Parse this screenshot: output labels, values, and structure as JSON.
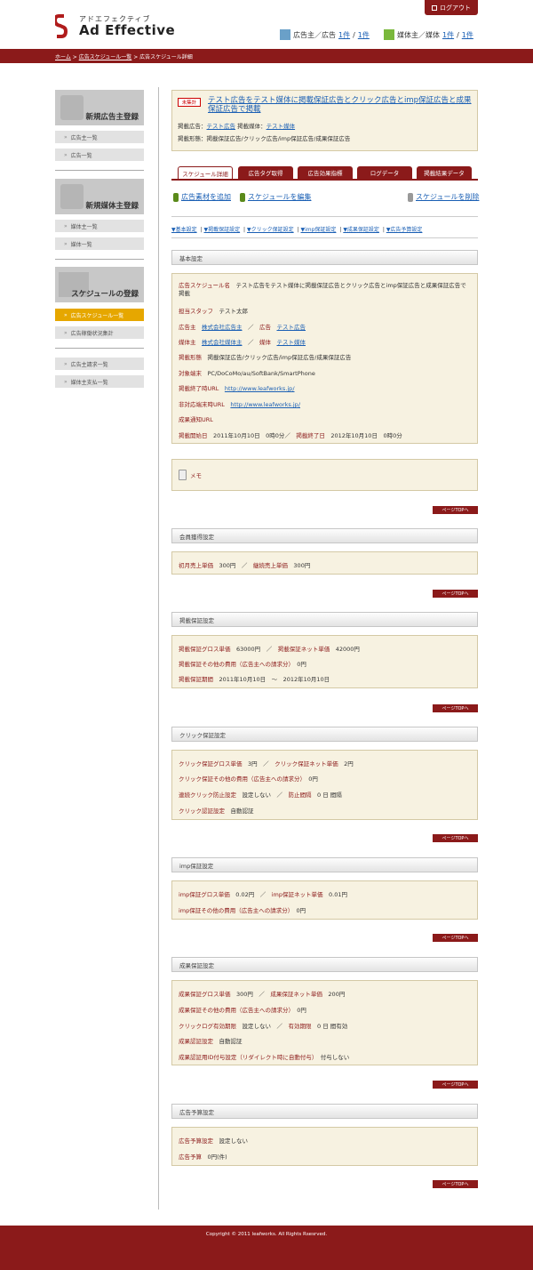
{
  "header": {
    "logout_label": "ログアウト",
    "logo_kana": "アドエフェクティブ",
    "logo_text": "Ad Effective",
    "advertiser_stat_label": "広告主／広告",
    "advertiser_count_a": "1件",
    "advertiser_count_b": "1件",
    "media_stat_label": "媒体主／媒体",
    "media_count_a": "1件",
    "media_count_b": "1件",
    "slash": "/"
  },
  "breadcrumb": {
    "home": "ホーム",
    "sep": ">",
    "list": "広告スケジュール一覧",
    "current": "広告スケジュール詳細"
  },
  "sidebar": {
    "banner_advertiser": "新規広告主登録",
    "advertiser_list": "広告主一覧",
    "ad_list": "広告一覧",
    "banner_media": "新規媒体主登録",
    "media_owner_list": "媒体主一覧",
    "media_list": "媒体一覧",
    "banner_schedule": "スケジュールの登録",
    "schedule_list": "広告スケジュール一覧",
    "status_summary": "広告稼働状況集計",
    "advertiser_invoices": "広告主請求一覧",
    "media_payments": "媒体主支払一覧"
  },
  "summary": {
    "badge": "未集計",
    "title": "テスト広告をテスト媒体に掲載保証広告とクリック広告とimp保証広告と成果保証広告で掲載",
    "ad_label": "掲載広告：",
    "ad_value": "テスト広告",
    "media_label": "掲載媒体：",
    "media_value": "テスト媒体",
    "form_label": "掲載形態：",
    "form_value": "掲載保証広告/クリック広告/imp保証広告/成果保証広告"
  },
  "tabs": [
    {
      "label": "スケジュール詳細"
    },
    {
      "label": "広告タグ取得"
    },
    {
      "label": "広告効果指標"
    },
    {
      "label": "ログデータ"
    },
    {
      "label": "掲載結果データ"
    }
  ],
  "actions": {
    "add_material": "広告素材を追加",
    "edit_schedule": "スケジュールを編集",
    "delete_schedule": "スケジュールを削除"
  },
  "anchors": [
    "▼基本設定",
    "▼掲載保証設定",
    "▼クリック保証設定",
    "▼imp保証設定",
    "▼成果保証設定",
    "▼広告予算設定"
  ],
  "anchor_sep": "|",
  "page_top": "ページTOPへ",
  "basic": {
    "heading": "基本設定",
    "schedule_name_label": "広告スケジュール名",
    "schedule_name_value": "テスト広告をテスト媒体に掲載保証広告とクリック広告とimp保証広告と成果保証広告で掲載",
    "staff_label": "担当スタッフ",
    "staff_value": "テスト太郎",
    "advertiser_label": "広告主",
    "advertiser_value": "株式会社広告主",
    "ad_label": "広告",
    "ad_value": "テスト広告",
    "owner_label": "媒体主",
    "owner_value": "株式会社媒体主",
    "media_label": "媒体",
    "media_value": "テスト媒体",
    "form_label": "掲載形態",
    "form_value": "掲載保証広告/クリック広告/imp保証広告/成果保証広告",
    "device_label": "対象端末",
    "device_value": "PC/DoCoMo/au/SoftBank/SmartPhone",
    "end_url_label": "掲載終了時URL",
    "end_url_value": "http://www.leafworks.jp/",
    "unsupported_url_label": "非対応端末時URL",
    "unsupported_url_value": "http://www.leafworks.jp/",
    "result_url_label": "成果通知URL",
    "start_label": "掲載開始日",
    "start_value": "2011年10月10日　0時0分",
    "end_label": "掲載終了日",
    "end_value": "2012年10月10日　0時0分",
    "slash": "／",
    "memo_label": "メモ"
  },
  "member": {
    "heading": "会員獲得設定",
    "first_label": "初月売上単価",
    "first_value": "300円",
    "cont_label": "継続売上単価",
    "cont_value": "300円"
  },
  "guarantee": {
    "heading": "掲載保証設定",
    "gross_label": "掲載保証グロス単価",
    "gross_value": "63000円",
    "net_label": "掲載保証ネット単価",
    "net_value": "42000円",
    "other_label": "掲載保証その他の費用（広告主への請求分）",
    "other_value": "0円",
    "period_label": "掲載保証期間",
    "period_value": "2011年10月10日　〜　2012年10月10日"
  },
  "click": {
    "heading": "クリック保証設定",
    "gross_label": "クリック保証グロス単価",
    "gross_value": "3円",
    "net_label": "クリック保証ネット単価",
    "net_value": "2円",
    "other_label": "クリック保証その他の費用（広告主への請求分）",
    "other_value": "0円",
    "repeat_label": "連続クリック防止設定",
    "repeat_value": "設定しない",
    "interval_label": "防止間隔",
    "interval_value": "0 日 間隔",
    "auth_label": "クリック認証設定",
    "auth_value": "自動認証"
  },
  "imp": {
    "heading": "imp保証設定",
    "gross_label": "imp保証グロス単価",
    "gross_value": "0.02円",
    "net_label": "imp保証ネット単価",
    "net_value": "0.01円",
    "other_label": "imp保証その他の費用（広告主への請求分）",
    "other_value": "0円"
  },
  "result": {
    "heading": "成果保証設定",
    "gross_label": "成果保証グロス単価",
    "gross_value": "300円",
    "net_label": "成果保証ネット単価",
    "net_value": "200円",
    "other_label": "成果保証その他の費用（広告主への請求分）",
    "other_value": "0円",
    "clicklog_label": "クリックログ有効期限",
    "clicklog_value": "設定しない",
    "validity_label": "有効期限",
    "validity_value": "0 日 間有効",
    "auth_label": "成果認証設定",
    "auth_value": "自動認証",
    "param_label": "成果認証用ID付与設定（リダイレクト時に自動付与）",
    "param_value": "付与しない"
  },
  "budget": {
    "heading": "広告予算設定",
    "setting_label": "広告予算設定",
    "setting_value": "設定しない",
    "amount_label": "広告予算",
    "amount_value": "0円(件)"
  },
  "footer": {
    "copyright": "Copyright © 2011 leafworks. All Rights Rsesrved."
  },
  "colors": {
    "brand": "#8b1a1a",
    "panel": "#f7f2e1",
    "active_sidebar": "#e6a700"
  }
}
